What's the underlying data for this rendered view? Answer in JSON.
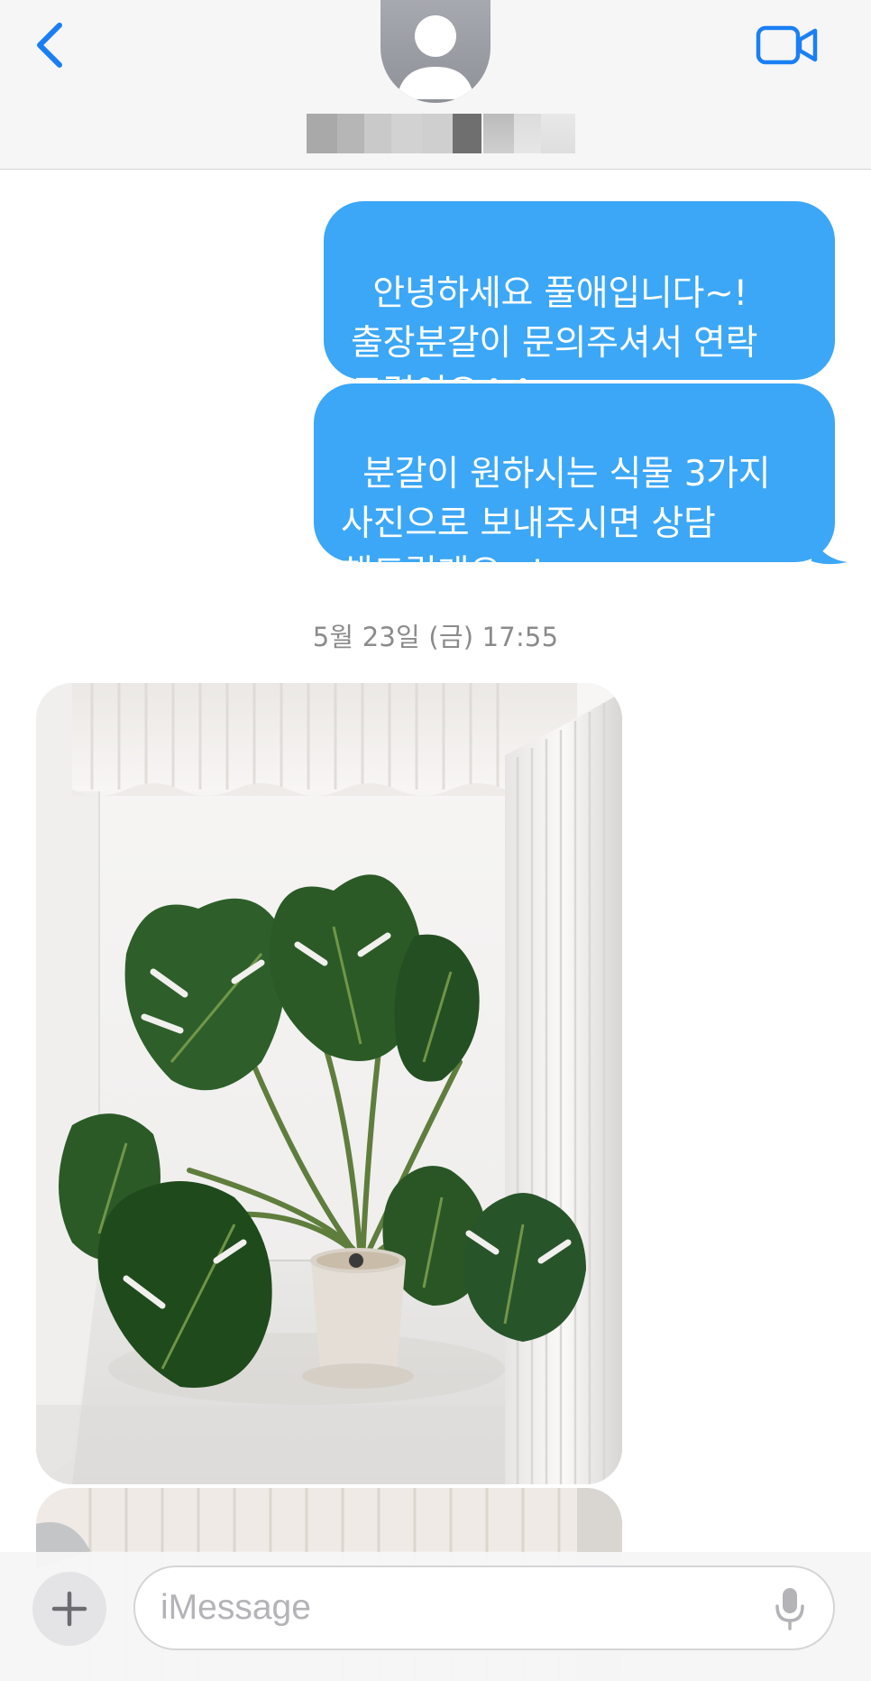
{
  "header": {
    "back_icon": "chevron-left-icon",
    "avatar_icon": "person-silhouette-icon",
    "video_icon": "video-camera-icon",
    "contact_name_redacted": true,
    "accent_color": "#1a7ff5"
  },
  "messages": [
    {
      "direction": "outgoing",
      "text": "안녕하세요 풀애입니다~!\n출장분갈이 문의주셔서 연락\n드렸어요^^"
    },
    {
      "direction": "outgoing",
      "text": "분갈이 원하시는 식물 3가지\n사진으로 보내주시면 상담\n해드릴게요~!"
    }
  ],
  "timestamp": "5월 23일 (금) 17:55",
  "attachments": [
    {
      "type": "photo",
      "subject": "monstera-plant-in-pot"
    },
    {
      "type": "photo",
      "subject": "curtain-partial"
    }
  ],
  "composer": {
    "placeholder": "iMessage",
    "value": "",
    "plus_icon": "plus-icon",
    "mic_icon": "microphone-icon"
  },
  "colors": {
    "bubble_outgoing": "#3ca7f6",
    "accent": "#1a7ff5",
    "timestamp_text": "#8b8b8b"
  }
}
